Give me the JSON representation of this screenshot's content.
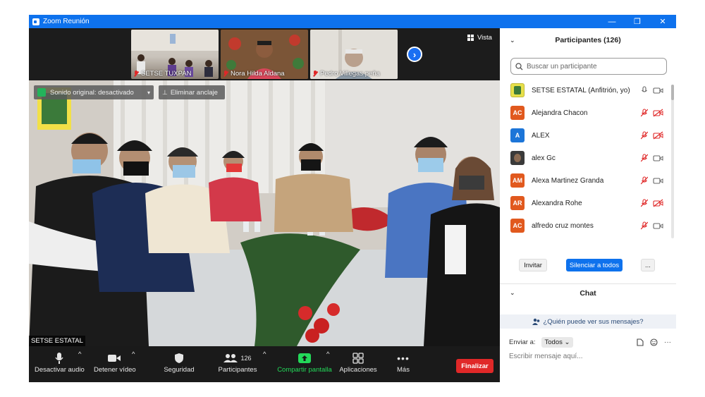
{
  "window": {
    "title": "Zoom Reunión",
    "minimize_glyph": "—",
    "restore_glyph": "❐",
    "close_glyph": "✕"
  },
  "thumbnails": [
    {
      "name": "SETSE TUXPAN",
      "muted": true
    },
    {
      "name": "Nora Hilda Aldana",
      "muted": true
    },
    {
      "name": "Pedro Villegas peña",
      "muted": true
    }
  ],
  "strip": {
    "next_glyph": "›",
    "view_label": "Vista"
  },
  "main_video": {
    "original_sound_label": "Sonido original: desactivado",
    "unpin_label": "Eliminar anclaje",
    "speaker_name": "SETSE ESTATAL"
  },
  "toolbar": {
    "mute_label": "Desactivar audio",
    "video_label": "Detener vídeo",
    "security_label": "Seguridad",
    "participants_label": "Participantes",
    "participants_count": "126",
    "share_label": "Compartir pantalla",
    "apps_label": "Aplicaciones",
    "more_label": "Más",
    "end_label": "Finalizar",
    "caret": "^",
    "share_color": "#23d959",
    "end_color": "#e02828"
  },
  "participants_panel": {
    "title": "Participantes (126)",
    "search_placeholder": "Buscar un participante",
    "participants": [
      {
        "name": "SETSE ESTATAL (Anfitrión, yo)",
        "initials": "",
        "color": "#e7e04a",
        "mic_muted": false,
        "video_off": false
      },
      {
        "name": "Alejandra Chacon",
        "initials": "AC",
        "color": "#e1591e",
        "mic_muted": true,
        "video_off": true
      },
      {
        "name": "ALEX",
        "initials": "A",
        "color": "#1c75d8",
        "mic_muted": true,
        "video_off": true
      },
      {
        "name": "alex Gc",
        "initials": "",
        "color": "#3a3a3a",
        "mic_muted": true,
        "video_off": false
      },
      {
        "name": "Alexa Martinez Granda",
        "initials": "AM",
        "color": "#e1591e",
        "mic_muted": true,
        "video_off": false
      },
      {
        "name": "Alexandra Rohe",
        "initials": "AR",
        "color": "#e1591e",
        "mic_muted": true,
        "video_off": true
      },
      {
        "name": "alfredo cruz montes",
        "initials": "AC",
        "color": "#e1591e",
        "mic_muted": true,
        "video_off": false
      }
    ],
    "invite_label": "Invitar",
    "mute_all_label": "Silenciar a todos",
    "more_label": "...",
    "mute_all_color": "#0e72ed"
  },
  "chat": {
    "title": "Chat",
    "who_sees_label": "¿Quién puede ver sus mensajes?",
    "send_to_label": "Enviar a:",
    "recipient": "Todos",
    "input_placeholder": "Escribir mensaje aquí..."
  }
}
